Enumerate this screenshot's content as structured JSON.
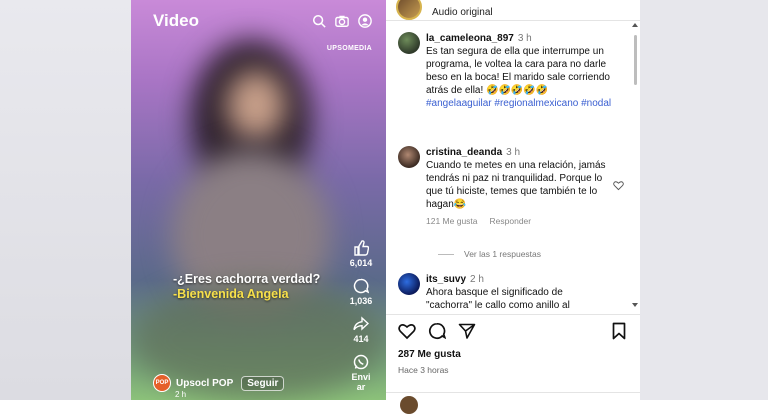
{
  "video": {
    "title": "Video",
    "watermark": "UPSOMEDIA",
    "subtitle_line1": "-¿Eres cachorra verdad?",
    "subtitle_line2": "-Bienvenida Angela",
    "actions": {
      "likes": "6,014",
      "comments": "1,036",
      "shares": "414",
      "send": "Enviar"
    },
    "channel": {
      "avatar_text": "POP",
      "name": "Upsocl POP",
      "follow": "Seguir",
      "time": "2 h"
    }
  },
  "panel": {
    "audio_label": "Audio original",
    "comments": [
      {
        "user": "la_cameleona_897",
        "time": "3 h",
        "text": "Es tan segura de ella que interrumpe un programa, le voltea la cara para no darle beso en la boca! El marido sale corriendo atrás de ella! 🤣🤣🤣🤣🤣",
        "tags": "#angelaaguilar #regionalmexicano #nodal"
      },
      {
        "user": "cristina_deanda",
        "time": "3 h",
        "text": "Cuando te metes en una relación, jamás tendrás ni paz ni tranquilidad. Porque lo que tú hiciste, temes que también te lo hagan😂",
        "likes": "121 Me gusta",
        "reply": "Responder",
        "view_replies": "Ver las 1 respuestas"
      },
      {
        "user": "its_suvy",
        "time": "2 h",
        "text": "Ahora basque el significado de \"cachorra\" le callo como anillo al"
      }
    ],
    "likes_count": "287 Me gusta",
    "posted": "Hace 3 horas"
  }
}
